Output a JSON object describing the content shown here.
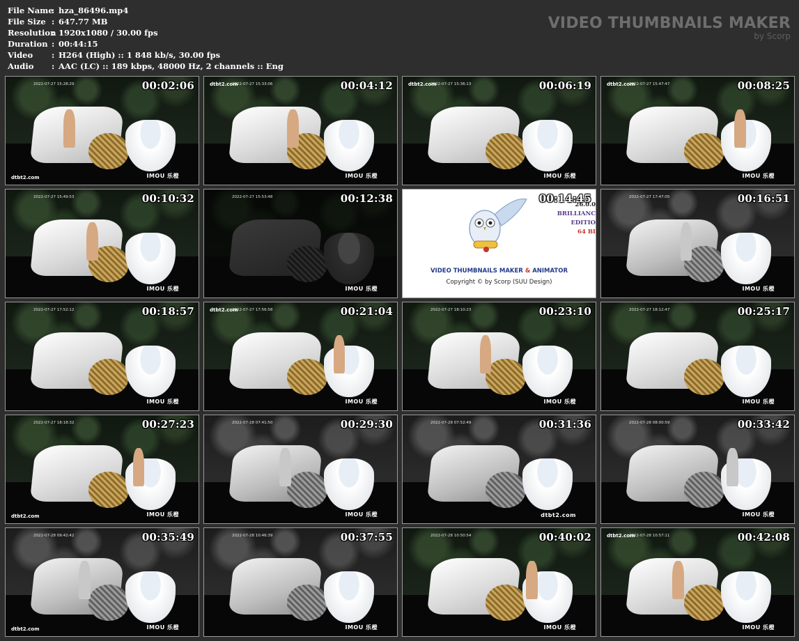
{
  "header": {
    "info": [
      {
        "label": "File Name",
        "sep": ":",
        "value": "hza_86496.mp4"
      },
      {
        "label": "File Size",
        "sep": ":",
        "value": "647.77 MB"
      },
      {
        "label": "Resolution",
        "sep": ":",
        "value": "1920x1080 / 30.00 fps"
      },
      {
        "label": "Duration",
        "sep": ":",
        "value": "00:44:15"
      },
      {
        "label": "Video",
        "sep": ":",
        "value": "H264 (High) :: 1 848 kb/s, 30.00 fps"
      },
      {
        "label": "Audio",
        "sep": ":",
        "value": "AAC (LC) :: 189 kbps, 48000 Hz, 2 channels :: Eng"
      }
    ],
    "brand_title": "VIDEO THUMBNAILS MAKER",
    "brand_sub": "by Scorp"
  },
  "thumbnails": [
    {
      "time": "00:02:06",
      "stamp": "2022-07-27 15:28:29",
      "logo_left": "dtbt2.com",
      "logo_right": "IMOU 乐橙",
      "tone": "color"
    },
    {
      "time": "00:04:12",
      "stamp": "2022-07-27 15:33:06",
      "logo_left": "dtbt2.com",
      "logo_right": "IMOU 乐橙",
      "tone": "color"
    },
    {
      "time": "00:06:19",
      "stamp": "2022-07-27 15:36:13",
      "logo_left": "dtbt2.com",
      "logo_right": "IMOU 乐橙",
      "tone": "color"
    },
    {
      "time": "00:08:25",
      "stamp": "2022-07-27 15:47:47",
      "logo_left": "dtbt2.com",
      "logo_right": "IMOU 乐橙",
      "tone": "color"
    },
    {
      "time": "00:10:32",
      "stamp": "2022-07-27 15:49:53",
      "logo_left": "",
      "logo_right": "IMOU 乐橙",
      "tone": "color"
    },
    {
      "time": "00:12:38",
      "stamp": "2022-07-27 15:53:48",
      "logo_left": "",
      "logo_right": "IMOU 乐橙",
      "tone": "dark"
    },
    {
      "time": "00:14:45",
      "special": true
    },
    {
      "time": "00:16:51",
      "stamp": "2022-07-27 17:47:05",
      "logo_left": "",
      "logo_right": "IMOU 乐橙",
      "tone": "gray"
    },
    {
      "time": "00:18:57",
      "stamp": "2022-07-27 17:52:12",
      "logo_left": "",
      "logo_right": "IMOU 乐橙",
      "tone": "color"
    },
    {
      "time": "00:21:04",
      "stamp": "2022-07-27 17:56:58",
      "logo_left": "dtbt2.com",
      "logo_right": "IMOU 乐橙",
      "tone": "color"
    },
    {
      "time": "00:23:10",
      "stamp": "2022-07-27 18:10:23",
      "logo_left": "",
      "logo_right": "IMOU 乐橙",
      "tone": "color"
    },
    {
      "time": "00:25:17",
      "stamp": "2022-07-27 18:12:47",
      "logo_left": "",
      "logo_right": "IMOU 乐橙",
      "tone": "color"
    },
    {
      "time": "00:27:23",
      "stamp": "2022-07-27 18:18:32",
      "logo_left": "dtbt2.com",
      "logo_right": "IMOU 乐橙",
      "tone": "color"
    },
    {
      "time": "00:29:30",
      "stamp": "2022-07-28 07:41:50",
      "logo_left": "",
      "logo_right": "IMOU 乐橙",
      "tone": "gray"
    },
    {
      "time": "00:31:36",
      "stamp": "2022-07-28 07:52:49",
      "logo_left": "",
      "logo_right": "dtbt2.com",
      "tone": "gray"
    },
    {
      "time": "00:33:42",
      "stamp": "2022-07-28 08:00:59",
      "logo_left": "",
      "logo_right": "IMOU 乐橙",
      "tone": "gray"
    },
    {
      "time": "00:35:49",
      "stamp": "2022-07-28 09:42:42",
      "logo_left": "dtbt2.com",
      "logo_right": "IMOU 乐橙",
      "tone": "gray"
    },
    {
      "time": "00:37:55",
      "stamp": "2022-07-28 10:46:39",
      "logo_left": "",
      "logo_right": "IMOU 乐橙",
      "tone": "gray"
    },
    {
      "time": "00:40:02",
      "stamp": "2022-07-28 10:50:54",
      "logo_left": "",
      "logo_right": "IMOU 乐橙",
      "tone": "color"
    },
    {
      "time": "00:42:08",
      "stamp": "2022-07-28 10:57:11",
      "logo_left": "dtbt2.com",
      "logo_right": "IMOU 乐橙",
      "tone": "color"
    }
  ],
  "promo": {
    "title_a": "VIDEO THUMBNAILS MAKER",
    "title_amp": "&",
    "title_b": "ANIMATOR",
    "copyright": "Copyright © by Scorp (SUU Design)",
    "ver_lines": [
      "26.0.0",
      "BRILLIANC",
      "EDITIO",
      "64 BI"
    ]
  }
}
